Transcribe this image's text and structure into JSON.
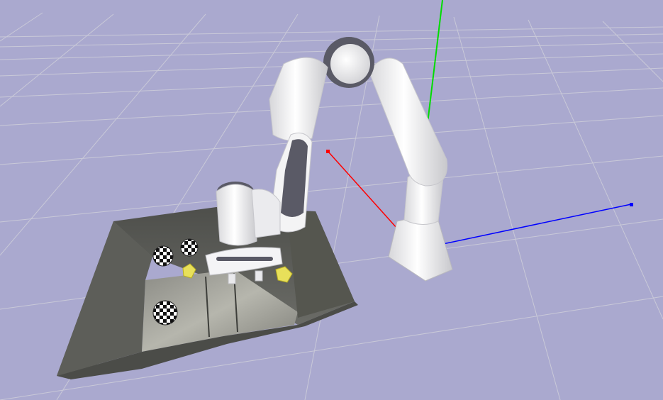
{
  "viewport": {
    "background": "#aaa9cf",
    "grid_color": "#c9c9d8",
    "axes": [
      {
        "name": "x",
        "color": "#ff0000"
      },
      {
        "name": "y",
        "color": "#00dd00"
      },
      {
        "name": "z",
        "color": "#0000ff"
      }
    ]
  },
  "scene": {
    "robot": {
      "type": "robot-arm",
      "link_color": "#f2f2f2",
      "joint_color": "#5a5a66"
    },
    "tray": {
      "color": "#5f605c"
    },
    "objects": [
      {
        "type": "checkered-sphere"
      },
      {
        "type": "checkered-sphere"
      },
      {
        "type": "checkered-sphere"
      },
      {
        "type": "yellow-cube"
      },
      {
        "type": "yellow-cube"
      }
    ]
  }
}
